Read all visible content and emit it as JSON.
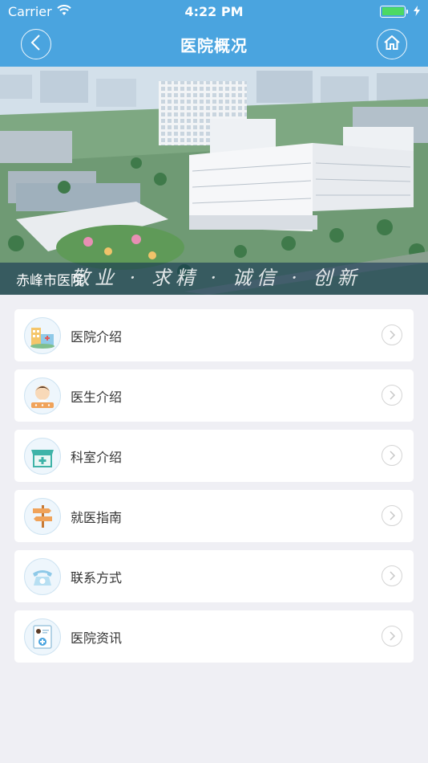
{
  "status_bar": {
    "carrier": "Carrier",
    "time": "4:22 PM",
    "battery_level": 1.0
  },
  "nav": {
    "title": "医院概况",
    "back_icon": "chevron-left-icon",
    "home_icon": "home-icon"
  },
  "banner": {
    "hospital_name": "赤峰市医院",
    "slogan": "敬业 · 求精 · 诚信 · 创新"
  },
  "menu": {
    "items": [
      {
        "label": "医院介绍",
        "icon": "hospital-building-icon"
      },
      {
        "label": "医生介绍",
        "icon": "doctor-avatar-icon"
      },
      {
        "label": "科室介绍",
        "icon": "department-clinic-icon"
      },
      {
        "label": "就医指南",
        "icon": "signpost-icon"
      },
      {
        "label": "联系方式",
        "icon": "telephone-icon"
      },
      {
        "label": "医院资讯",
        "icon": "news-document-icon"
      }
    ]
  },
  "colors": {
    "header": "#4aa4df",
    "background": "#efeff4",
    "battery": "#4cd964"
  }
}
